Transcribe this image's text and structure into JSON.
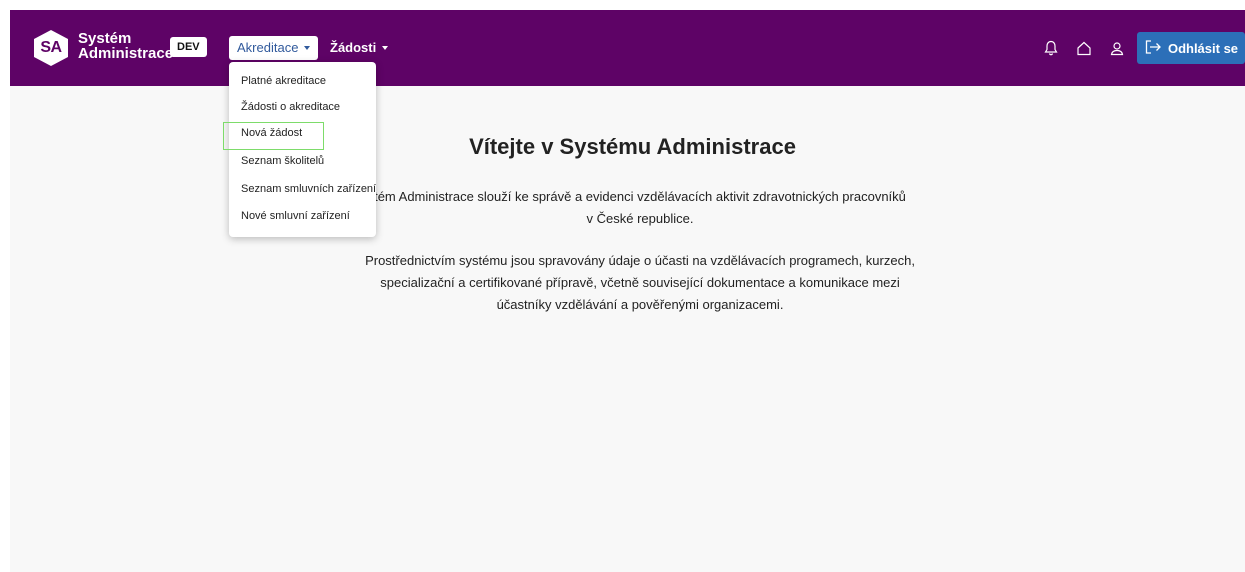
{
  "header": {
    "logo_abbr": "SA",
    "app_title_line1": "Systém",
    "app_title_line2": "Administrace",
    "env_badge": "DEV",
    "nav": {
      "akreditace": "Akreditace",
      "zadosti": "Žádosti"
    },
    "logout_label": "Odhlásit se"
  },
  "dropdown": {
    "items": [
      "Platné akreditace",
      "Žádosti o akreditace",
      "Nová žádost",
      "Seznam školitelů",
      "Seznam smluvních zařízení",
      "Nové smluvní zařízení"
    ]
  },
  "main": {
    "title": "Vítejte v Systému Administrace",
    "para1_line1": "tém Administrace slouží ke správě a evidenci vzdělávacích aktivit zdravotnických pracovníků",
    "para1_line2": "v České republice.",
    "para2_line1": "Prostřednictvím systému jsou spravovány údaje o účasti na vzdělávacích programech, kurzech,",
    "para2_line2": "specializační a certifikované přípravě, včetně související dokumentace a komunikace mezi",
    "para2_line3": "účastníky vzdělávání a pověřenými organizacemi."
  },
  "colors": {
    "header_bg": "#5e0366",
    "logout_bg": "#2c6fb8",
    "highlight": "#7ddc6a"
  }
}
